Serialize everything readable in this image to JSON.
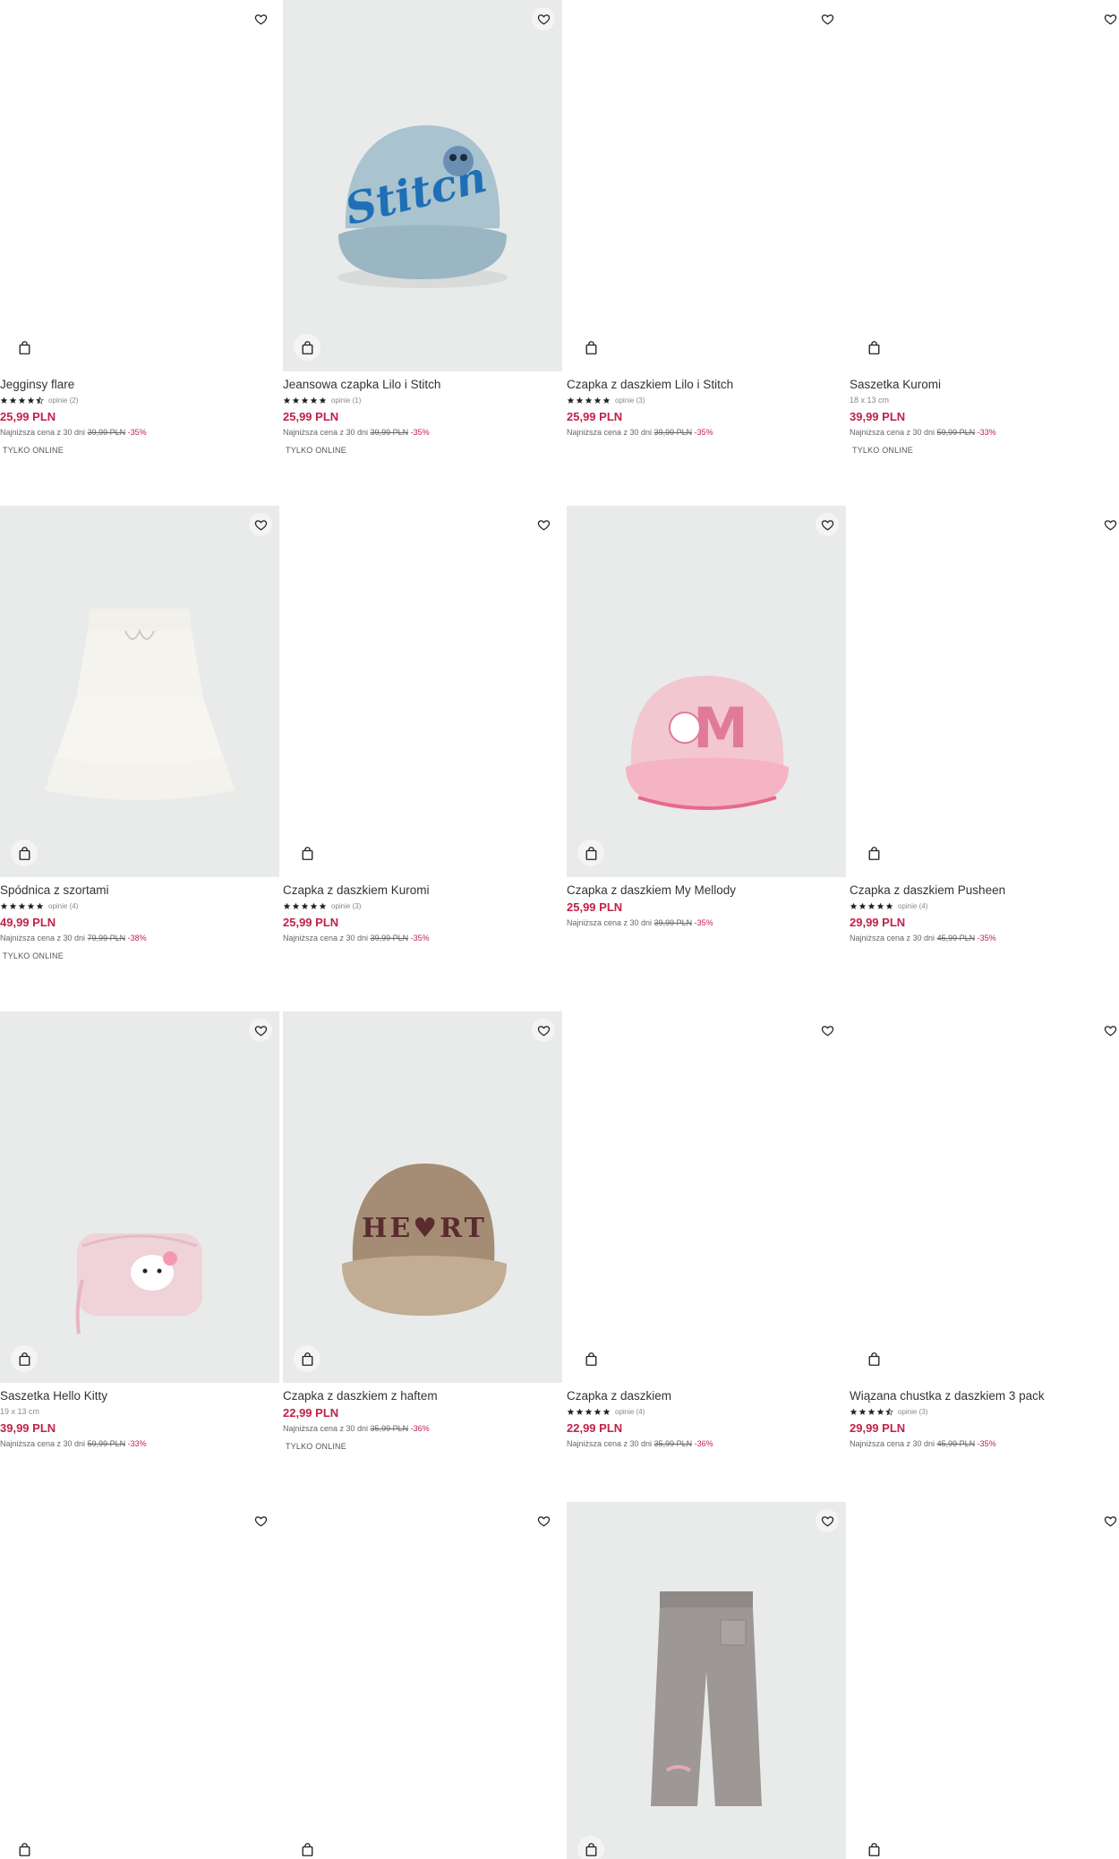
{
  "labels": {
    "only_online": "TYLKO ONLINE",
    "lowest_prefix": "Najniższa cena z 30 dni"
  },
  "colors": {
    "price": "#c0224b",
    "image_bg": "#e9eaea"
  },
  "products": [
    {
      "name": "Jegginsy flare",
      "rating": 4.5,
      "reviews": "opinie (2)",
      "size": "",
      "price": "25,99 PLN",
      "old_price": "39,99 PLN",
      "discount": "-35%",
      "online": true,
      "photo": ""
    },
    {
      "name": "Jeansowa czapka Lilo i Stitch",
      "rating": 5,
      "reviews": "opinie (1)",
      "size": "",
      "price": "25,99 PLN",
      "old_price": "39,99 PLN",
      "discount": "-35%",
      "online": true,
      "photo": "stitch-cap",
      "photo_text": "Stitch"
    },
    {
      "name": "Czapka z daszkiem Lilo i Stitch",
      "rating": 5,
      "reviews": "opinie (3)",
      "size": "",
      "price": "25,99 PLN",
      "old_price": "39,99 PLN",
      "discount": "-35%",
      "online": false,
      "photo": ""
    },
    {
      "name": "Saszetka Kuromi",
      "rating": 0,
      "reviews": "",
      "size": "18 x 13 cm",
      "price": "39,99 PLN",
      "old_price": "59,99 PLN",
      "discount": "-33%",
      "online": true,
      "photo": ""
    },
    {
      "name": "Spódnica z szortami",
      "rating": 5,
      "reviews": "opinie (4)",
      "size": "",
      "price": "49,99 PLN",
      "old_price": "79,99 PLN",
      "discount": "-38%",
      "online": true,
      "photo": "skirt"
    },
    {
      "name": "Czapka z daszkiem Kuromi",
      "rating": 5,
      "reviews": "opinie (3)",
      "size": "",
      "price": "25,99 PLN",
      "old_price": "39,99 PLN",
      "discount": "-35%",
      "online": false,
      "photo": ""
    },
    {
      "name": "Czapka z daszkiem My Mellody",
      "rating": 0,
      "reviews": "",
      "size": "",
      "price": "25,99 PLN",
      "old_price": "39,99 PLN",
      "discount": "-35%",
      "online": false,
      "photo": "melody-cap",
      "photo_text": "M"
    },
    {
      "name": "Czapka z daszkiem Pusheen",
      "rating": 5,
      "reviews": "opinie (4)",
      "size": "",
      "price": "29,99 PLN",
      "old_price": "45,99 PLN",
      "discount": "-35%",
      "online": false,
      "photo": ""
    },
    {
      "name": "Saszetka Hello Kitty",
      "rating": 0,
      "reviews": "",
      "size": "19 x 13 cm",
      "price": "39,99 PLN",
      "old_price": "59,99 PLN",
      "discount": "-33%",
      "online": false,
      "photo": "kitty-pouch"
    },
    {
      "name": "Czapka z daszkiem z haftem",
      "rating": 0,
      "reviews": "",
      "size": "",
      "price": "22,99 PLN",
      "old_price": "35,99 PLN",
      "discount": "-36%",
      "online": true,
      "photo": "heart-cap",
      "photo_text": "HE♥RT"
    },
    {
      "name": "Czapka z daszkiem",
      "rating": 5,
      "reviews": "opinie (4)",
      "size": "",
      "price": "22,99 PLN",
      "old_price": "35,99 PLN",
      "discount": "-36%",
      "online": false,
      "photo": ""
    },
    {
      "name": "Wiązana chustka z daszkiem 3 pack",
      "rating": 4.5,
      "reviews": "opinie (3)",
      "size": "",
      "price": "29,99 PLN",
      "old_price": "45,99 PLN",
      "discount": "-35%",
      "online": false,
      "photo": ""
    },
    {
      "name": "",
      "rating": 0,
      "reviews": "",
      "size": "",
      "price": "",
      "old_price": "",
      "discount": "",
      "online": false,
      "photo": ""
    },
    {
      "name": "",
      "rating": 0,
      "reviews": "",
      "size": "",
      "price": "",
      "old_price": "",
      "discount": "",
      "online": false,
      "photo": ""
    },
    {
      "name": "",
      "rating": 0,
      "reviews": "",
      "size": "",
      "price": "",
      "old_price": "",
      "discount": "",
      "online": false,
      "photo": "trousers"
    },
    {
      "name": "",
      "rating": 0,
      "reviews": "",
      "size": "",
      "price": "",
      "old_price": "",
      "discount": "",
      "online": false,
      "photo": ""
    }
  ]
}
